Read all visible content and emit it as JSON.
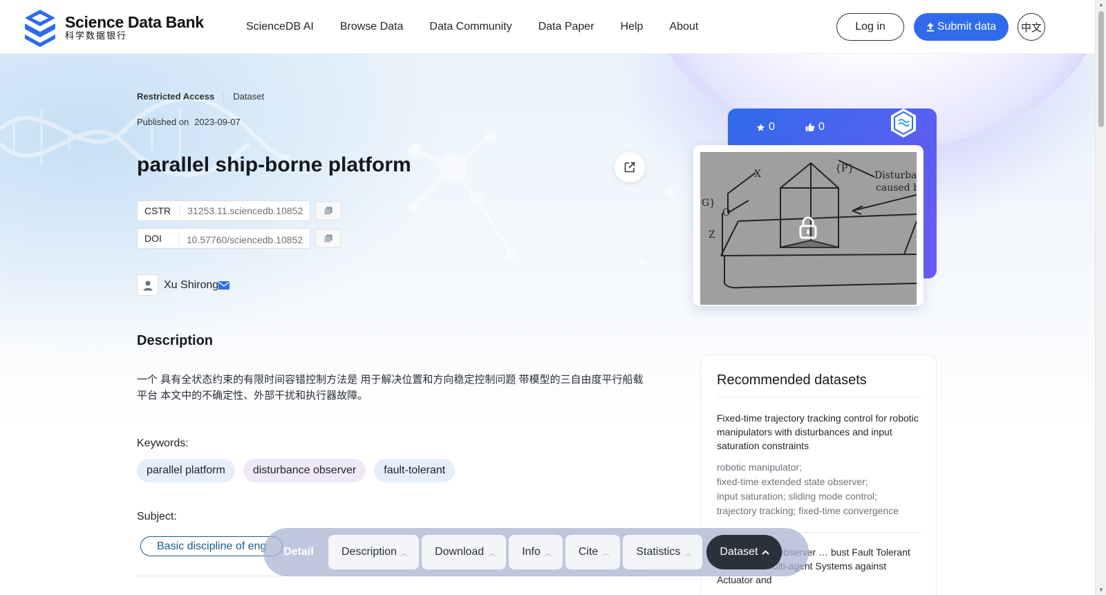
{
  "header": {
    "logo_en": "Science Data Bank",
    "logo_zh": "科学数据银行",
    "nav": [
      "ScienceDB AI",
      "Browse Data",
      "Data Community",
      "Data Paper",
      "Help",
      "About"
    ],
    "login_label": "Log in",
    "submit_label": "Submit data",
    "lang_label": "中文"
  },
  "dataset": {
    "access": "Restricted Access",
    "type": "Dataset",
    "published_label": "Published on",
    "published_date": "2023-09-07",
    "title": "parallel ship-borne platform",
    "cstr_label": "CSTR",
    "cstr_value": "31253.11.sciencedb.10852",
    "doi_label": "DOI",
    "doi_value": "10.57760/sciencedb.10852",
    "author": "Xu Shirong"
  },
  "description": {
    "heading": "Description",
    "text": "一个 具有全状态约束的有限时间容错控制方法是 用于解决位置和方向稳定控制问题 带模型的三自由度平行船载平台 本文中的不确定性、外部干扰和执行器故障。"
  },
  "keywords": {
    "label": "Keywords:",
    "items": [
      "parallel platform",
      "disturbance observer",
      "fault-tolerant"
    ],
    "colors": [
      "#e6eefb",
      "#efe8f8",
      "#e6eefb"
    ]
  },
  "subject": {
    "label": "Subject:",
    "value": "Basic discipline of eng"
  },
  "stats": {
    "stars": "0",
    "likes": "0"
  },
  "recommended": {
    "heading": "Recommended datasets",
    "items": [
      {
        "title": "Fixed-time trajectory tracking control for robotic manipulators with disturbances and input saturation constraints",
        "keywords": "robotic manipulator;\nfixed-time extended state observer;\ninput saturation; sliding mode control;\ntrajectory tracking; fixed-time convergence"
      },
      {
        "title": "Sliding-Mode Observer … bust Fault Tolerant Control for Multi-agent Systems against Actuator and"
      }
    ]
  },
  "tabbar": {
    "detail_label": "Detail",
    "tabs": [
      "Description",
      "Download",
      "Info",
      "Cite",
      "Statistics"
    ],
    "active_tab": "Dataset"
  },
  "colors": {
    "accent": "#2f6bea",
    "tab_active": "#2b313b",
    "subject_border": "#1c5a8d"
  }
}
